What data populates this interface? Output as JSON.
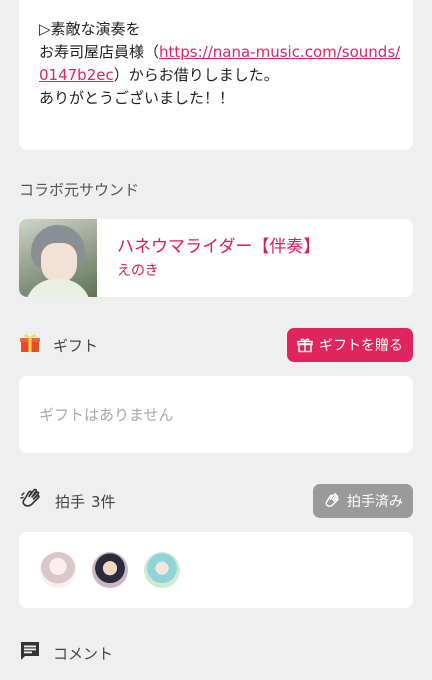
{
  "description": {
    "line1": "▷素敵な演奏を",
    "line2_prefix": "お寿司屋店員様（",
    "link_part1": "https://nana-music.com/sounds/",
    "link_part2": "0147b2ec",
    "line3_suffix": "）からお借りしました。",
    "line4": "ありがとうございました！！"
  },
  "collab": {
    "section_title": "コラボ元サウンド",
    "song_title": "ハネウマライダー【伴奏】",
    "artist": "えのき"
  },
  "gift": {
    "section_title": "ギフト",
    "button_label": "ギフトを贈る",
    "empty_text": "ギフトはありません"
  },
  "applause": {
    "section_title": "拍手",
    "count": "3件",
    "button_label": "拍手済み",
    "users": [
      "user-1",
      "user-2",
      "user-3"
    ]
  },
  "comments": {
    "section_title": "コメント"
  },
  "colors": {
    "accent": "#e0245e",
    "link": "#e0245e",
    "applause_button": "#9a9a9a",
    "background": "#efefef"
  },
  "icons": {
    "gift": "gift-icon",
    "applause": "clap-icon",
    "comment": "comment-icon"
  }
}
